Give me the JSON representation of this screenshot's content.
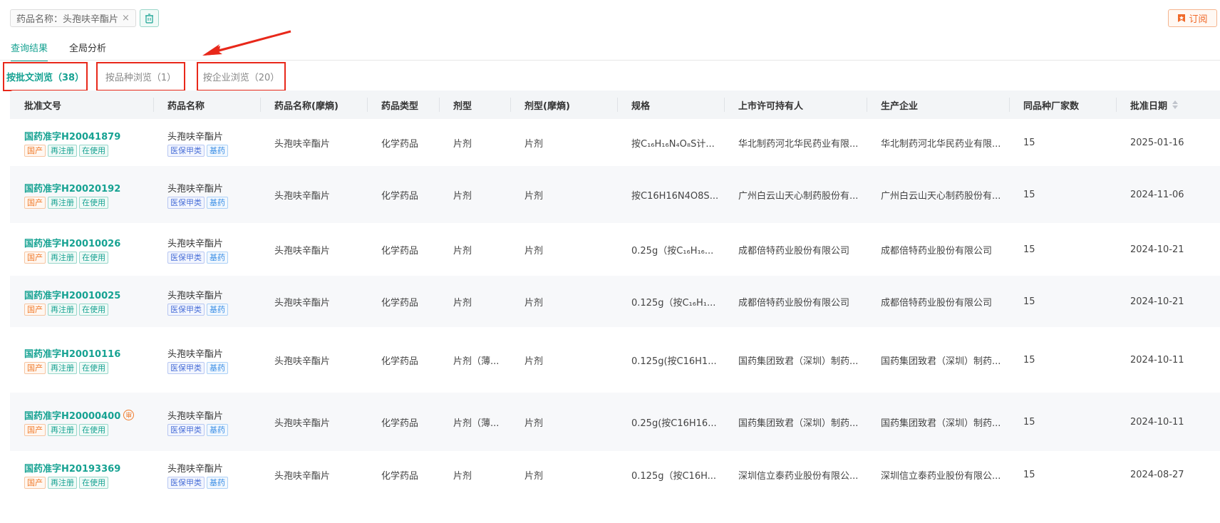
{
  "filter": {
    "chip_label": "药品名称：头孢呋辛酯片",
    "close_glyph": "×"
  },
  "subscribe": {
    "label": "订阅",
    "color": "#f06a2a"
  },
  "main_tabs": [
    {
      "label": "查询结果",
      "active": true
    },
    {
      "label": "全局分析",
      "active": false
    }
  ],
  "browse_tabs": [
    {
      "label": "按批文浏览（38）",
      "active": true
    },
    {
      "label": "按品种浏览（1）",
      "active": false
    },
    {
      "label": "按企业浏览（20）",
      "active": false
    }
  ],
  "table": {
    "headers": [
      "批准文号",
      "药品名称",
      "药品名称(摩熵)",
      "药品类型",
      "剂型",
      "剂型(摩熵)",
      "规格",
      "上市许可持有人",
      "生产企业",
      "同品种厂家数",
      "批准日期"
    ],
    "rows": [
      {
        "approval": "国药准字H20041879",
        "badge": "",
        "status_tags": [
          "国产",
          "再注册",
          "在使用"
        ],
        "drug_name": "头孢呋辛酯片",
        "drug_tags": [
          "医保甲类",
          "基药"
        ],
        "moshang_name": "头孢呋辛酯片",
        "drug_type": "化学药品",
        "dosage_form": "片剂",
        "moshang_form": "片剂",
        "spec": "按C₁₆H₁₆N₄O₈S计...",
        "holder": "华北制药河北华民药业有限...",
        "manufacturer": "华北制药河北华民药业有限...",
        "count": "15",
        "date": "2025-01-16"
      },
      {
        "approval": "国药准字H20020192",
        "badge": "",
        "status_tags": [
          "国产",
          "再注册",
          "在使用"
        ],
        "drug_name": "头孢呋辛酯片",
        "drug_tags": [
          "医保甲类",
          "基药"
        ],
        "moshang_name": "头孢呋辛酯片",
        "drug_type": "化学药品",
        "dosage_form": "片剂",
        "moshang_form": "片剂",
        "spec": "按C16H16N4O8S...",
        "holder": "广州白云山天心制药股份有...",
        "manufacturer": "广州白云山天心制药股份有...",
        "count": "15",
        "date": "2024-11-06"
      },
      {
        "approval": "国药准字H20010026",
        "badge": "",
        "status_tags": [
          "国产",
          "再注册",
          "在使用"
        ],
        "drug_name": "头孢呋辛酯片",
        "drug_tags": [
          "医保甲类",
          "基药"
        ],
        "moshang_name": "头孢呋辛酯片",
        "drug_type": "化学药品",
        "dosage_form": "片剂",
        "moshang_form": "片剂",
        "spec": "0.25g（按C₁₆H₁₆...",
        "holder": "成都倍特药业股份有限公司",
        "manufacturer": "成都倍特药业股份有限公司",
        "count": "15",
        "date": "2024-10-21"
      },
      {
        "approval": "国药准字H20010025",
        "badge": "",
        "status_tags": [
          "国产",
          "再注册",
          "在使用"
        ],
        "drug_name": "头孢呋辛酯片",
        "drug_tags": [
          "医保甲类",
          "基药"
        ],
        "moshang_name": "头孢呋辛酯片",
        "drug_type": "化学药品",
        "dosage_form": "片剂",
        "moshang_form": "片剂",
        "spec": "0.125g（按C₁₆H₁...",
        "holder": "成都倍特药业股份有限公司",
        "manufacturer": "成都倍特药业股份有限公司",
        "count": "15",
        "date": "2024-10-21"
      },
      {
        "approval": "国药准字H20010116",
        "badge": "",
        "status_tags": [
          "国产",
          "再注册",
          "在使用"
        ],
        "drug_name": "头孢呋辛酯片",
        "drug_tags": [
          "医保甲类",
          "基药"
        ],
        "moshang_name": "头孢呋辛酯片",
        "drug_type": "化学药品",
        "dosage_form": "片剂（薄...",
        "moshang_form": "片剂",
        "spec": "0.125g(按C16H1...",
        "holder": "国药集团致君（深圳）制药...",
        "manufacturer": "国药集团致君（深圳）制药...",
        "count": "15",
        "date": "2024-10-11"
      },
      {
        "approval": "国药准字H20000400",
        "badge": "审",
        "status_tags": [
          "国产",
          "再注册",
          "在使用"
        ],
        "drug_name": "头孢呋辛酯片",
        "drug_tags": [
          "医保甲类",
          "基药"
        ],
        "moshang_name": "头孢呋辛酯片",
        "drug_type": "化学药品",
        "dosage_form": "片剂（薄...",
        "moshang_form": "片剂",
        "spec": "0.25g(按C16H16...",
        "holder": "国药集团致君（深圳）制药...",
        "manufacturer": "国药集团致君（深圳）制药...",
        "count": "15",
        "date": "2024-10-11"
      },
      {
        "approval": "国药准字H20193369",
        "badge": "",
        "status_tags": [
          "国产",
          "再注册",
          "在使用"
        ],
        "drug_name": "头孢呋辛酯片",
        "drug_tags": [
          "医保甲类",
          "基药"
        ],
        "moshang_name": "头孢呋辛酯片",
        "drug_type": "化学药品",
        "dosage_form": "片剂",
        "moshang_form": "片剂",
        "spec": "0.125g（按C16H...",
        "holder": "深圳信立泰药业股份有限公...",
        "manufacturer": "深圳信立泰药业股份有限公...",
        "count": "15",
        "date": "2024-08-27"
      }
    ]
  },
  "colors": {
    "accent": "#16a292",
    "highlight_border": "#e8281a",
    "orange": "#f07a2a"
  },
  "icons": {
    "clear": "trash-icon",
    "subscribe": "bookmark-icon",
    "sort": "sort-icon",
    "badge": "review-badge-icon"
  }
}
